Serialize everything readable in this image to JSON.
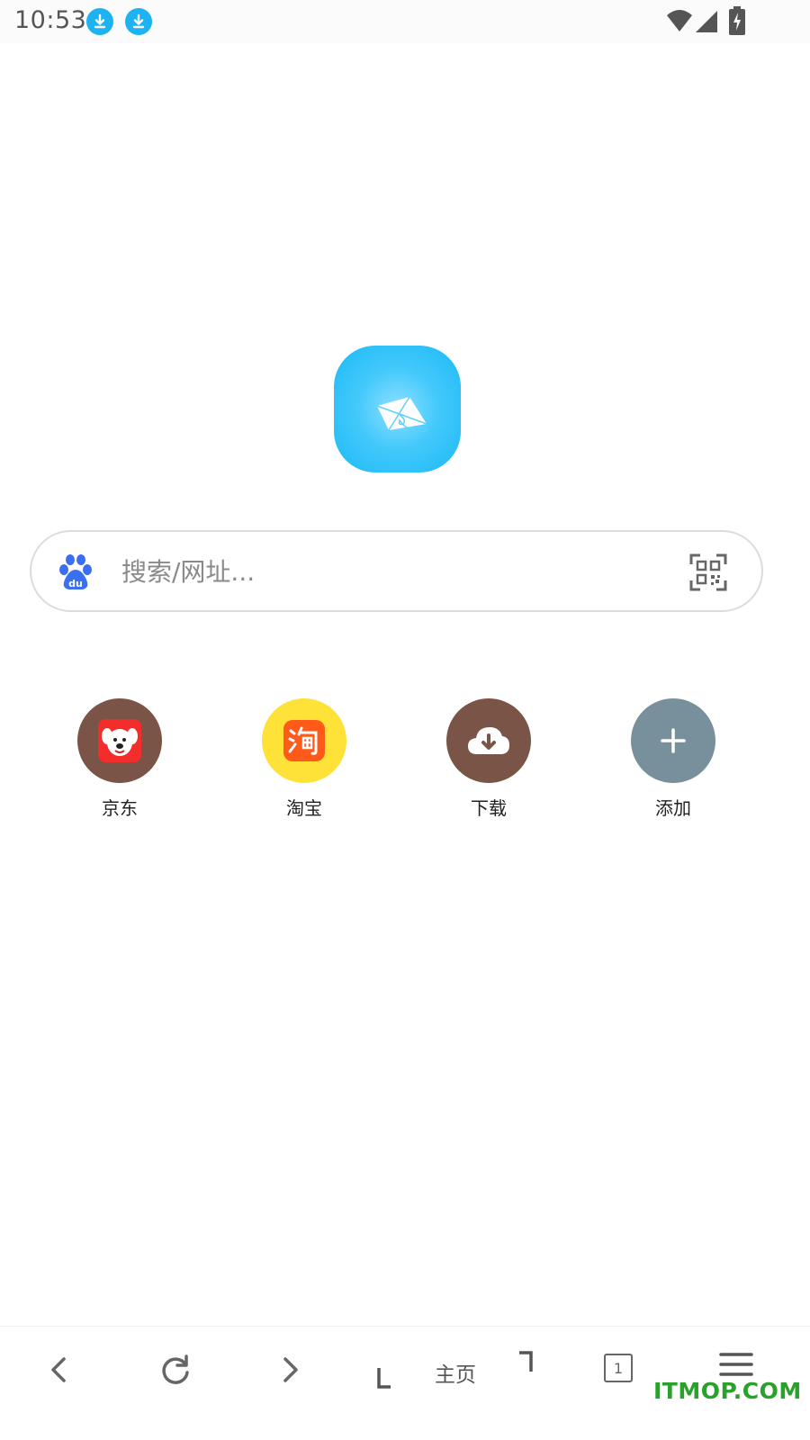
{
  "status_bar": {
    "time": "10:53",
    "notification_icons": [
      "download-icon",
      "download-icon"
    ],
    "system_icons": [
      "wifi-icon",
      "signal-icon",
      "battery-charging-icon"
    ]
  },
  "logo": {
    "name": "kite-logo",
    "color": "#33c3f8"
  },
  "search": {
    "placeholder": "搜索/网址...",
    "value": "",
    "engine_icon": "baidu-icon",
    "scan_icon": "qr-scan-icon"
  },
  "shortcuts": [
    {
      "label": "京东",
      "icon": "jd-icon",
      "bg": "#7a5446"
    },
    {
      "label": "淘宝",
      "icon": "taobao-icon",
      "bg": "#ffe237"
    },
    {
      "label": "下载",
      "icon": "cloud-download-icon",
      "bg": "#7a5446"
    },
    {
      "label": "添加",
      "icon": "plus-icon",
      "bg": "#78909c"
    }
  ],
  "bottom_nav": {
    "back_icon": "back-icon",
    "refresh_icon": "refresh-icon",
    "forward_icon": "forward-icon",
    "home_label": "主页",
    "tab_count": "1",
    "menu_icon": "menu-icon"
  },
  "watermark": "ITMOP.COM"
}
